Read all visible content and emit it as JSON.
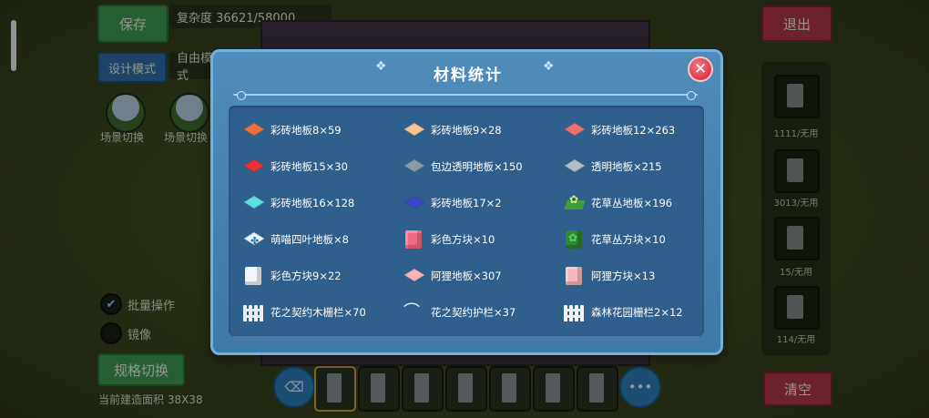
{
  "background": {
    "save_button": "保存",
    "complexity_text": "复杂度 36621/58000",
    "design_mode_button": "设计模式",
    "free_button": "自由模式",
    "thumb_labels": [
      "场景切换",
      "场景切换"
    ],
    "exit_button": "退出",
    "right_slots": [
      "1111/无用",
      "3013/无用",
      "15/无用",
      "114/无用"
    ],
    "batch_op_label": "批量操作",
    "mirror_label": "镜像",
    "spec_switch_button": "规格切换",
    "build_area_text": "当前建造面积 38X38",
    "clear_button": "清空",
    "more_button": "•••"
  },
  "modal": {
    "title": "材料统计",
    "close_icon": "✕",
    "items": [
      {
        "label": "彩砖地板8×59",
        "icon": "diamond",
        "color": "#f0703a"
      },
      {
        "label": "彩砖地板9×28",
        "icon": "diamond",
        "color": "#f7c58e"
      },
      {
        "label": "彩砖地板12×263",
        "icon": "diamond",
        "color": "#f07070"
      },
      {
        "label": "彩砖地板15×30",
        "icon": "diamond",
        "color": "#ee3030"
      },
      {
        "label": "包边透明地板×150",
        "icon": "diamond",
        "color": "#8a9aa6"
      },
      {
        "label": "透明地板×215",
        "icon": "diamond",
        "color": "#b3bec6"
      },
      {
        "label": "彩砖地板16×128",
        "icon": "diamond",
        "color": "#5ee0e0"
      },
      {
        "label": "彩砖地板17×2",
        "icon": "diamond",
        "color": "#3c48c8"
      },
      {
        "label": "花草丛地板×196",
        "icon": "sprout",
        "color": "#3e9f3a"
      },
      {
        "label": "萌喵四叶地板×8",
        "icon": "clover",
        "color": "#e8f6ff"
      },
      {
        "label": "彩色方块×10",
        "icon": "cube",
        "color": "#f26a7f"
      },
      {
        "label": "花草丛方块×10",
        "icon": "bush",
        "color": "#2d8a32"
      },
      {
        "label": "彩色方块9×22",
        "icon": "cube",
        "color": "#f4f7fa"
      },
      {
        "label": "阿狸地板×307",
        "icon": "diamond",
        "color": "#f7b4b4"
      },
      {
        "label": "阿狸方块×13",
        "icon": "cube",
        "color": "#f8b7b9"
      },
      {
        "label": "花之契约木栅栏×70",
        "icon": "fence",
        "color": "#e9eef8"
      },
      {
        "label": "花之契约护栏×37",
        "icon": "hook",
        "color": "#f1f5fa"
      },
      {
        "label": "森林花园栅栏2×12",
        "icon": "fence",
        "color": "#f4f4f4"
      }
    ]
  }
}
